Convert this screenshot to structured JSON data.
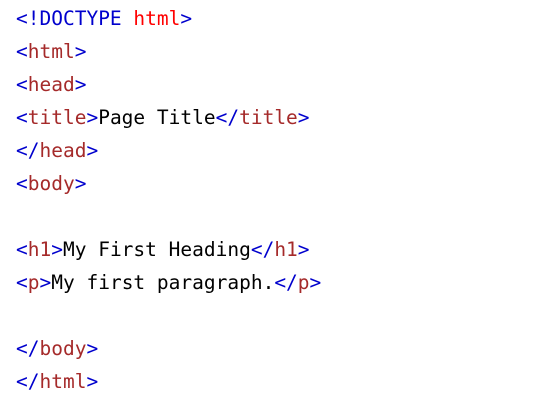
{
  "colors": {
    "bracket": "#0000cd",
    "tag_name": "#a52a2a",
    "attribute": "#ff0000",
    "text": "#000000",
    "background": "#ffffff"
  },
  "code": {
    "doctype_keyword": "!DOCTYPE",
    "doctype_value": "html",
    "tag_html": "html",
    "tag_head": "head",
    "tag_title": "title",
    "title_text": "Page Title",
    "tag_body": "body",
    "tag_h1": "h1",
    "h1_text": "My First Heading",
    "tag_p": "p",
    "p_text": "My first paragraph."
  }
}
